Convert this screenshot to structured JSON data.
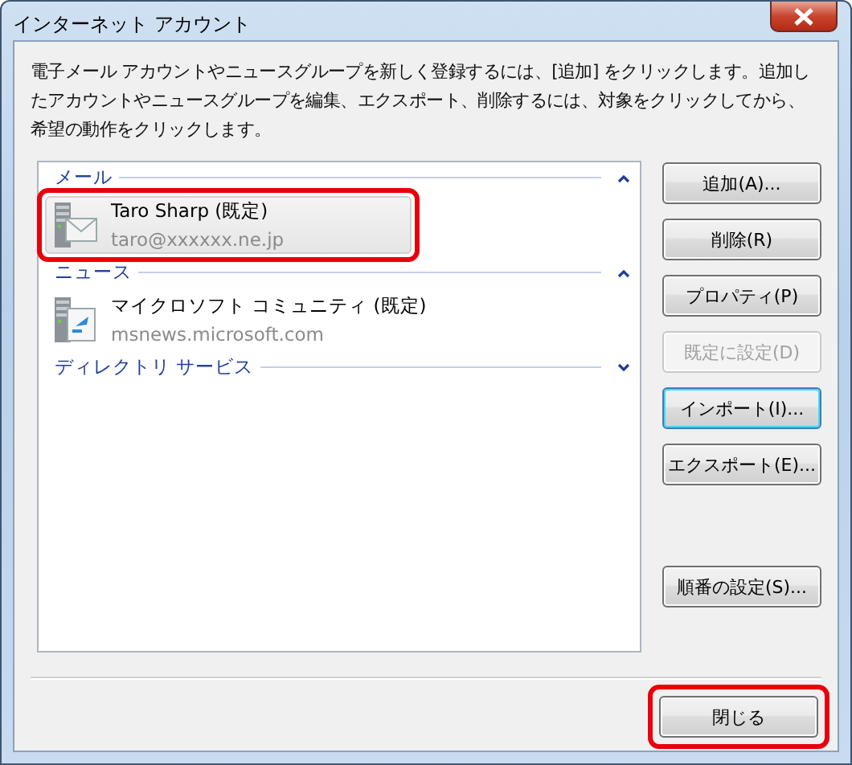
{
  "window": {
    "title": "インターネット アカウント"
  },
  "description": "電子メール アカウントやニュースグループを新しく登録するには、[追加] をクリックします。追加したアカウントやニュースグループを編集、エクスポート、削除するには、対象をクリックしてから、希望の動作をクリックします。",
  "groups": [
    {
      "title": "メール",
      "expanded": true,
      "items": [
        {
          "name": "Taro Sharp (既定)",
          "detail": "taro@xxxxxx.ne.jp",
          "kind": "mail",
          "selected": true,
          "highlighted": true
        }
      ]
    },
    {
      "title": "ニュース",
      "expanded": true,
      "items": [
        {
          "name": "マイクロソフト コミュニティ (既定)",
          "detail": "msnews.microsoft.com",
          "kind": "news",
          "selected": false,
          "highlighted": false
        }
      ]
    },
    {
      "title": "ディレクトリ サービス",
      "expanded": false
    }
  ],
  "button_groups": [
    [
      {
        "label": "追加(A)...",
        "disabled": false,
        "focused": false
      },
      {
        "label": "削除(R)",
        "disabled": false,
        "focused": false
      },
      {
        "label": "プロパティ(P)",
        "disabled": false,
        "focused": false
      },
      {
        "label": "既定に設定(D)",
        "disabled": true,
        "focused": false
      },
      {
        "label": "インポート(I)...",
        "disabled": false,
        "focused": true
      },
      {
        "label": "エクスポート(E)...",
        "disabled": false,
        "focused": false
      }
    ],
    [
      {
        "label": "順番の設定(S)...",
        "disabled": false,
        "focused": false
      }
    ]
  ],
  "close_button": {
    "label": "閉じる",
    "highlighted": true
  }
}
